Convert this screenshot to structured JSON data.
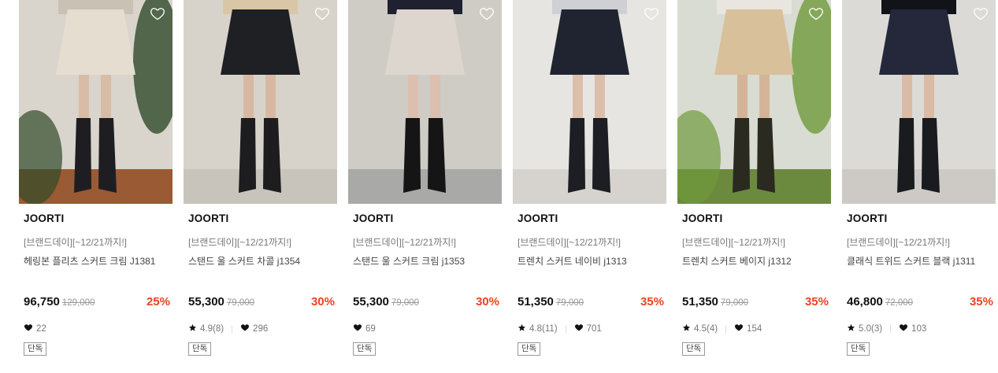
{
  "products": [
    {
      "brand": "JOORTI",
      "promo": "[브랜드데이][~12/21까지!]",
      "name": "헤링본 플리츠 스커트 크림 J1381",
      "price": "96,750",
      "original_price": "129,000",
      "discount": "25%",
      "rating": "",
      "likes": "22",
      "badge": "단독",
      "image": {
        "bg": "#d9d4cc",
        "skirt": "#e4ddd0",
        "top": "#c9c1b3",
        "boots": "#1e1e22",
        "legs": "#d8bca6",
        "floor": "#9a5a33",
        "plant": "#2f4a2a"
      }
    },
    {
      "brand": "JOORTI",
      "promo": "[브랜드데이][~12/21까지!]",
      "name": "스탠드 울 스커트 차콜 j1354",
      "price": "55,300",
      "original_price": "79,000",
      "discount": "30%",
      "rating": "4.9(8)",
      "likes": "296",
      "badge": "단독",
      "image": {
        "bg": "#d8d3ca",
        "skirt": "#1e2024",
        "top": "#d9c6a6",
        "boots": "#1d1d20",
        "legs": "#d7b9a3",
        "floor": "#c9c4bb",
        "plant": ""
      }
    },
    {
      "brand": "JOORTI",
      "promo": "[브랜드데이][~12/21까지!]",
      "name": "스탠드 울 스커트 크림 j1353",
      "price": "55,300",
      "original_price": "79,000",
      "discount": "30%",
      "rating": "",
      "likes": "69",
      "badge": "단독",
      "image": {
        "bg": "#cfccc6",
        "skirt": "#ddd6cf",
        "top": "#1f2130",
        "boots": "#151515",
        "legs": "#dcbfae",
        "floor": "#a9aaa8",
        "plant": ""
      }
    },
    {
      "brand": "JOORTI",
      "promo": "[브랜드데이][~12/21까지!]",
      "name": "트렌치 스커트 네이비 j1313",
      "price": "51,350",
      "original_price": "79,000",
      "discount": "35%",
      "rating": "4.8(11)",
      "likes": "701",
      "badge": "단독",
      "image": {
        "bg": "#e7e5e1",
        "skirt": "#1f2430",
        "top": "#cfd0d3",
        "boots": "#1c1e24",
        "legs": "#dcbfaa",
        "floor": "#d6d3ce",
        "plant": ""
      }
    },
    {
      "brand": "JOORTI",
      "promo": "[브랜드데이][~12/21까지!]",
      "name": "트렌치 스커트 베이지 j1312",
      "price": "51,350",
      "original_price": "79,000",
      "discount": "35%",
      "rating": "4.5(4)",
      "likes": "154",
      "badge": "단독",
      "image": {
        "bg": "#d9dcd2",
        "skirt": "#d8c09a",
        "top": "#e9e6e0",
        "boots": "#2a2a20",
        "legs": "#d4b498",
        "floor": "#6c8a3e",
        "plant": "#6f9a3c"
      }
    },
    {
      "brand": "JOORTI",
      "promo": "[브랜드데이][~12/21까지!]",
      "name": "클래식 트위드 스커트 블랙 j1311",
      "price": "46,800",
      "original_price": "72,000",
      "discount": "35%",
      "rating": "5.0(3)",
      "likes": "103",
      "badge": "단독",
      "image": {
        "bg": "#dcdad6",
        "skirt": "#24283a",
        "top": "#111318",
        "boots": "#1a1b1f",
        "legs": "#d9bba6",
        "floor": "#cdcac5",
        "plant": ""
      }
    }
  ]
}
